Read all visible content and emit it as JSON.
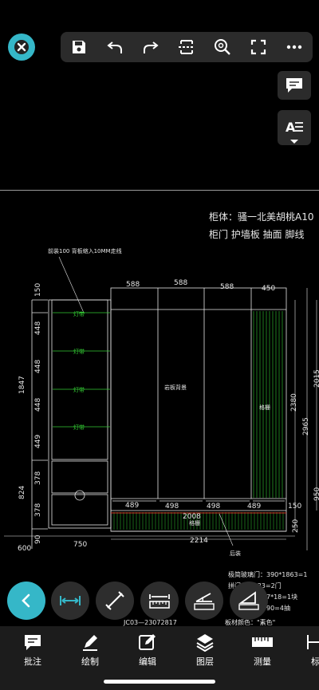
{
  "toolbar": {
    "icons": [
      "close-icon",
      "save-icon",
      "undo-icon",
      "redo-icon",
      "section-icon",
      "zoom-icon",
      "fullscreen-icon",
      "more-icon"
    ]
  },
  "side": {
    "comment_icon": "comment-icon",
    "text_icon": "text-size-icon"
  },
  "drawing": {
    "title_line1": "柜体：骚一北美胡桃A10",
    "title_line2": "柜门  护墙板  抽面  脚线",
    "note_top": "前装100  背板缩入10MM走线",
    "top_dims": [
      "588",
      "588",
      "588",
      "450"
    ],
    "left_dims": [
      "150",
      "448",
      "448",
      "448",
      "449",
      "378",
      "378",
      "90"
    ],
    "left_total_upper": "1847",
    "left_total_lower": "824",
    "bottom_dims": [
      "489",
      "498",
      "498",
      "489"
    ],
    "width_2008": "2008",
    "width_2214": "2214",
    "width_750": "750",
    "width_600": "600",
    "right_dims": [
      "2380",
      "2965",
      "2015",
      "950",
      "250"
    ],
    "right_150": "150",
    "shelf_label": "灯带",
    "center_label": "岩板背景",
    "right_label": "格栅",
    "bottom_label": "格栅",
    "rear_label": "后装",
    "spec_line1": "极简玻璃门：390*1863=1",
    "spec_line2": "拼门 ：1833=2门",
    "spec_line3": "7*18=1块",
    "spec_line4": "90=4抽",
    "footer_left": "JC03—23072817",
    "footer_right": "板材颜色：\"素色\""
  },
  "circle_tools": [
    "back-icon",
    "horizontal-measure-icon",
    "aligned-measure-icon",
    "ruler-icon",
    "angle-icon",
    "area-icon"
  ],
  "nav": [
    {
      "label": "批注",
      "icon": "comment-icon"
    },
    {
      "label": "绘制",
      "icon": "pen-icon"
    },
    {
      "label": "编辑",
      "icon": "edit-icon"
    },
    {
      "label": "图层",
      "icon": "layers-icon"
    },
    {
      "label": "测量",
      "icon": "measure-icon"
    },
    {
      "label": "标",
      "icon": "tag-icon"
    }
  ],
  "colors": {
    "accent": "#35b7c8",
    "cad_green": "#33cc33",
    "cad_white": "#e6e6e6",
    "cad_red": "#d23a2a"
  }
}
